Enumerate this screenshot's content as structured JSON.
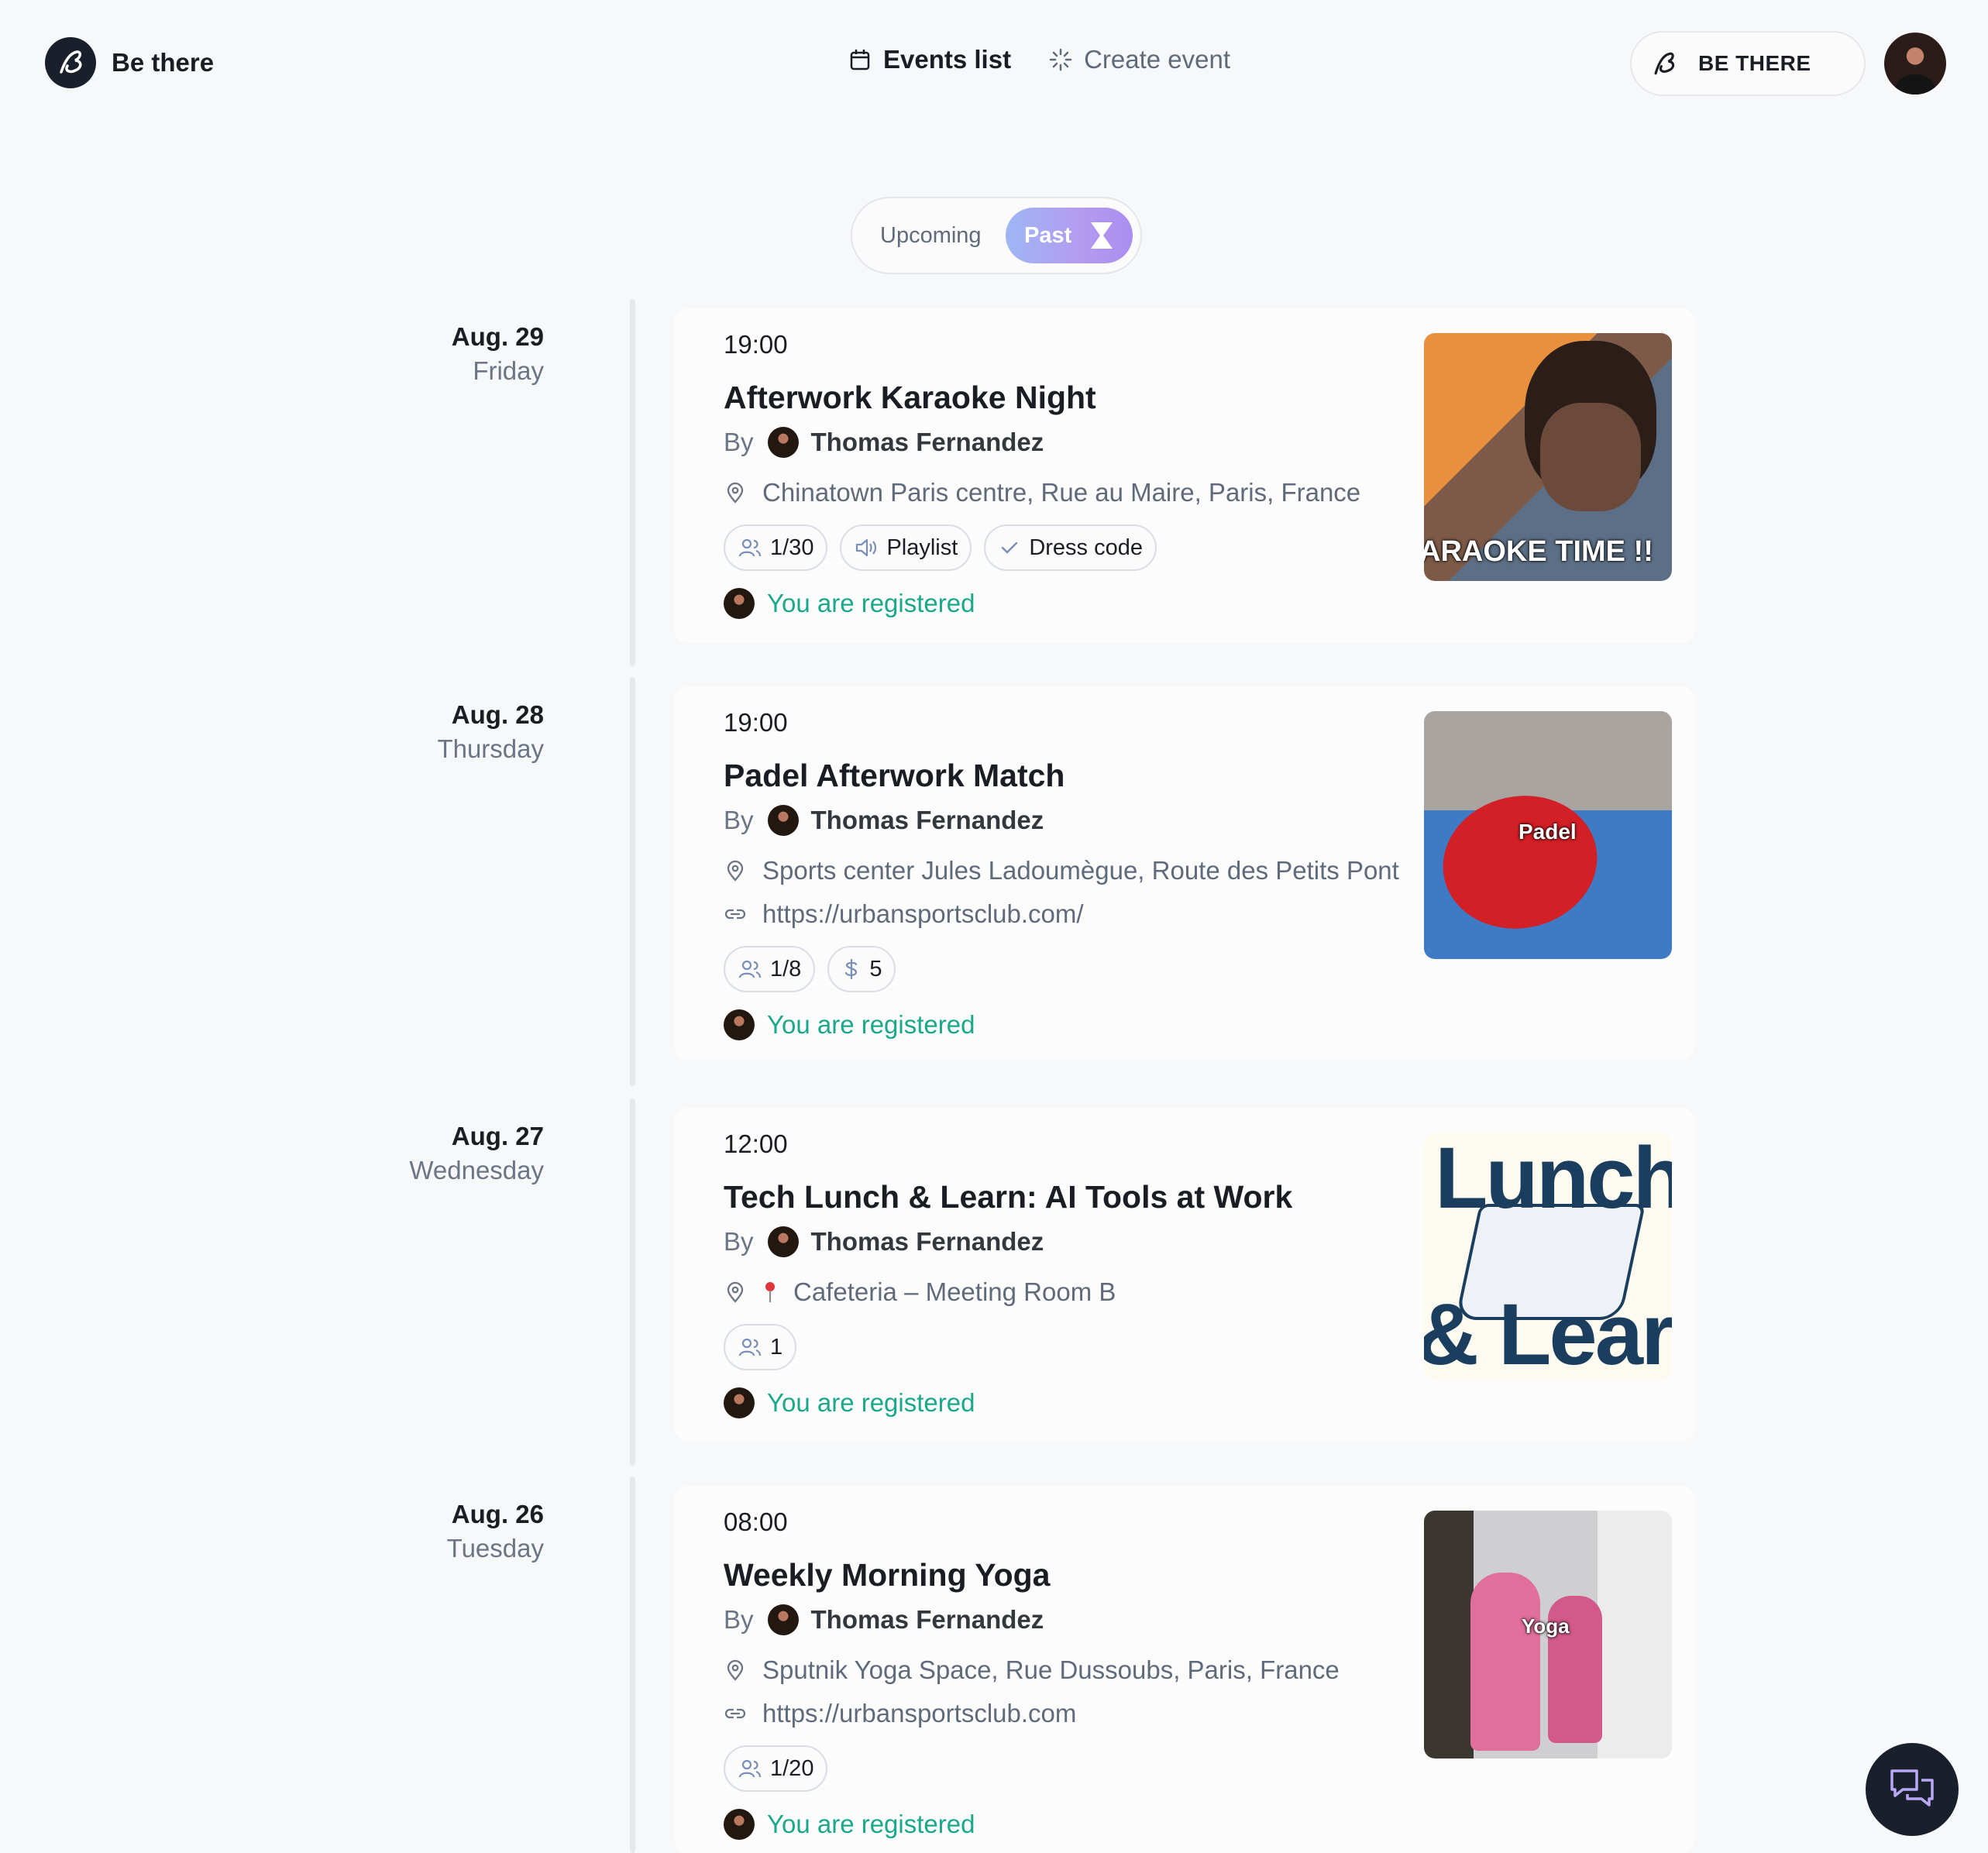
{
  "app": {
    "name": "Be there"
  },
  "nav": {
    "events_list": "Events list",
    "create_event": "Create event"
  },
  "brand_pill": {
    "label": "BE THERE"
  },
  "toggle": {
    "upcoming": "Upcoming",
    "past": "Past"
  },
  "events": [
    {
      "date": "Aug. 29",
      "weekday": "Friday",
      "time": "19:00",
      "title": "Afterwork Karaoke Night",
      "by": "By",
      "host": "Thomas Fernandez",
      "location": "Chinatown Paris centre, Rue au Maire, Paris, France",
      "chips": {
        "attendees": "1/30",
        "playlist": "Playlist",
        "dress_code": "Dress code"
      },
      "status": "You are registered",
      "image": {
        "icon": "karaoke-image",
        "caption": "ARAOKE TIME !!"
      }
    },
    {
      "date": "Aug. 28",
      "weekday": "Thursday",
      "time": "19:00",
      "title": "Padel Afterwork Match",
      "by": "By",
      "host": "Thomas Fernandez",
      "location": "Sports center Jules Ladoumègue, Route des Petits Pont",
      "link": "https://urbansportsclub.com/",
      "chips": {
        "attendees": "1/8",
        "price": "5"
      },
      "status": "You are registered",
      "image": {
        "icon": "padel-image",
        "caption": "Padel"
      }
    },
    {
      "date": "Aug. 27",
      "weekday": "Wednesday",
      "time": "12:00",
      "title": "Tech Lunch & Learn: AI Tools at Work",
      "by": "By",
      "host": "Thomas Fernandez",
      "location": "Cafeteria – Meeting Room B",
      "chips": {
        "attendees": "1"
      },
      "status": "You are registered",
      "image": {
        "icon": "lunch-learn-image",
        "caption_top": "Lunch",
        "caption_bottom": "& Learn"
      }
    },
    {
      "date": "Aug. 26",
      "weekday": "Tuesday",
      "time": "08:00",
      "title": "Weekly Morning Yoga",
      "by": "By",
      "host": "Thomas Fernandez",
      "location": "Sputnik Yoga Space, Rue Dussoubs, Paris, France",
      "link": "https://urbansportsclub.com",
      "chips": {
        "attendees": "1/20"
      },
      "status": "You are registered",
      "image": {
        "icon": "yoga-image",
        "caption": "Yoga"
      }
    }
  ],
  "colors": {
    "registered": "#1aa88a",
    "accent_gradient_start": "#9eb7f4",
    "accent_gradient_end": "#a98ef0",
    "dark": "#1a1f2c"
  }
}
